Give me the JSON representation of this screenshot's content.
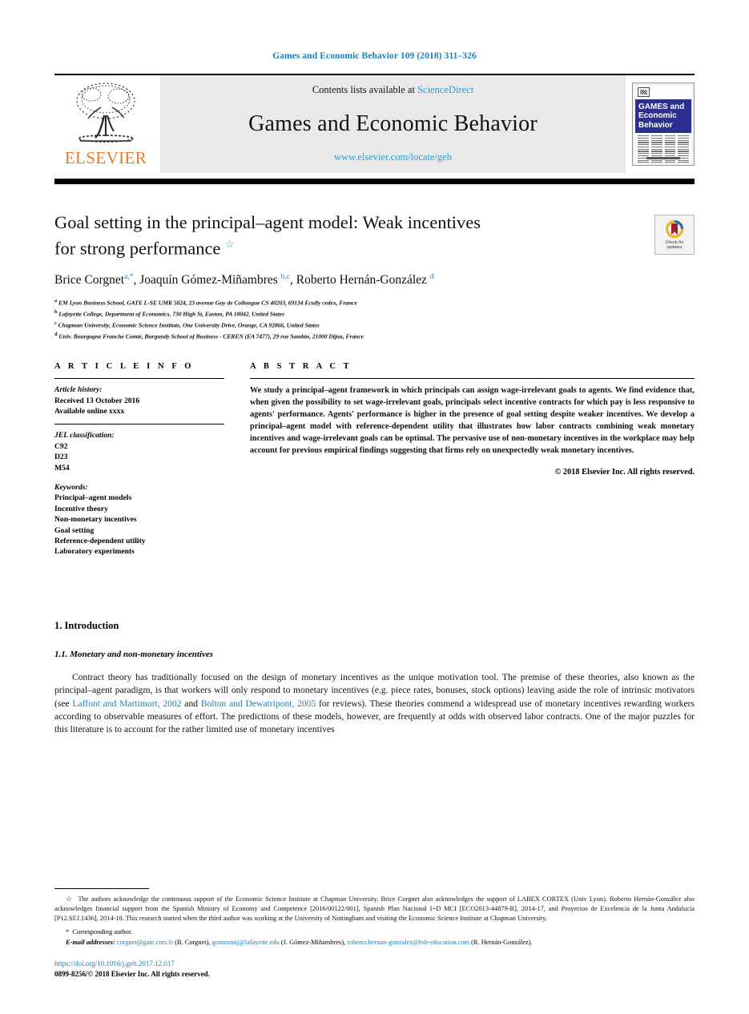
{
  "running_head": "Games and Economic Behavior 109 (2018) 311–326",
  "masthead": {
    "contents_prefix": "Contents lists available at ",
    "sciencedirect": "ScienceDirect",
    "journal_title": "Games and Economic Behavior",
    "journal_url": "www.elsevier.com/locate/geb",
    "publisher_logo_text": "ELSEVIER",
    "cover_title_line1": "GAMES and",
    "cover_title_line2": "Economic",
    "cover_title_line3": "Behavior"
  },
  "article": {
    "title_line1": "Goal setting in the principal–agent model: Weak incentives",
    "title_line2": "for strong performance",
    "title_footnote_marker": "☆",
    "crossmark_label_line1": "Check for",
    "crossmark_label_line2": "updates",
    "authors": [
      {
        "name": "Brice Corgnet",
        "sup": "a,*"
      },
      {
        "name": "Joaquín Gómez-Miñambres",
        "sup": "b,c"
      },
      {
        "name": "Roberto Hernán-González",
        "sup": "d"
      }
    ],
    "affiliations": [
      {
        "label": "a",
        "text": "EM Lyon Business School, GATE L-SE UMR 5824, 23 avenue Guy de Collongue CS 40203, 69134 Ecully cedex, France"
      },
      {
        "label": "b",
        "text": "Lafayette College, Department of Economics, 730 High St, Easton, PA 18042, United States"
      },
      {
        "label": "c",
        "text": "Chapman University, Economic Science Institute, One University Drive, Orange, CA 92866, United States"
      },
      {
        "label": "d",
        "text": "Univ. Bourgogne Franche Comté, Burgundy School of Business - CEREN (EA 7477), 29 rue Sambin, 21000 Dijon, France"
      }
    ]
  },
  "article_info": {
    "heading": "A R T I C L E  I N F O",
    "history_label": "Article history:",
    "history": [
      "Received 13 October 2016",
      "Available online xxxx"
    ],
    "jel_label": "JEL classification:",
    "jel": [
      "C92",
      "D23",
      "M54"
    ],
    "keywords_label": "Keywords:",
    "keywords": [
      "Principal–agent models",
      "Incentive theory",
      "Non-monetary incentives",
      "Goal setting",
      "Reference-dependent utility",
      "Laboratory experiments"
    ]
  },
  "abstract": {
    "heading": "A B S T R A C T",
    "text": "We study a principal–agent framework in which principals can assign wage-irrelevant goals to agents. We find evidence that, when given the possibility to set wage-irrelevant goals, principals select incentive contracts for which pay is less responsive to agents' performance. Agents' performance is higher in the presence of goal setting despite weaker incentives. We develop a principal–agent model with reference-dependent utility that illustrates how labor contracts combining weak monetary incentives and wage-irrelevant goals can be optimal. The pervasive use of non-monetary incentives in the workplace may help account for previous empirical findings suggesting that firms rely on unexpectedly weak monetary incentives.",
    "copyright": "© 2018 Elsevier Inc. All rights reserved."
  },
  "body": {
    "section_number_title": "1. Introduction",
    "subsection_title": "1.1. Monetary and non-monetary incentives",
    "paragraph_part1": "Contract theory has traditionally focused on the design of monetary incentives as the unique motivation tool. The premise of these theories, also known as the principal–agent paradigm, is that workers will only respond to monetary incentives (e.g. piece rates, bonuses, stock options) leaving aside the role of intrinsic motivators (see ",
    "citation1": "Laffont and Martimort, 2002",
    "paragraph_mid": " and ",
    "citation2": "Bolton and Dewatripont, 2005",
    "paragraph_part2": " for reviews). These theories commend a widespread use of monetary incentives rewarding workers according to observable measures of effort. The predictions of these models, however, are frequently at odds with observed labor contracts. One of the major puzzles for this literature is to account for the rather limited use of monetary incentives"
  },
  "footnotes": {
    "acknowledgement_marker": "☆",
    "acknowledgement": "The authors acknowledge the continuous support of the Economic Science Institute at Chapman University. Brice Corgnet also acknowledges the support of LABEX CORTEX (Univ Lyon). Roberto Hernán-González also acknowledges financial support from the Spanish Ministry of Economy and Competence [2016/00122/001], Spanish Plan Nacional I+D MCI [ECO2013-44879-R], 2014-17, and Proyectos de Excelencia de la Junta Andalucía [P12.SEJ.1436], 2014-18. This research started when the third author was working at the University of Nottingham and visiting the Economic Science Institute at Chapman University.",
    "corresponding_marker": "*",
    "corresponding": "Corresponding author.",
    "email_label": "E-mail addresses:",
    "emails": [
      {
        "address": "corgnet@gate.cnrs.fr",
        "owner": "(B. Corgnet)"
      },
      {
        "address": "gomezmij@lafayette.edu",
        "owner": "(J. Gómez-Miñambres)"
      },
      {
        "address": "roberto.hernan-gonzalez@bsb-education.com",
        "owner": "(R. Hernán-González)"
      }
    ],
    "doi": "https://doi.org/10.1016/j.geb.2017.12.017",
    "issn_line": "0899-8256/© 2018 Elsevier Inc. All rights reserved."
  },
  "colors": {
    "link_blue": "#1a7fb5",
    "sciencedirect_blue": "#2a9fd6",
    "elsevier_orange": "#E8792A",
    "cover_navy": "#2b2f8f"
  }
}
